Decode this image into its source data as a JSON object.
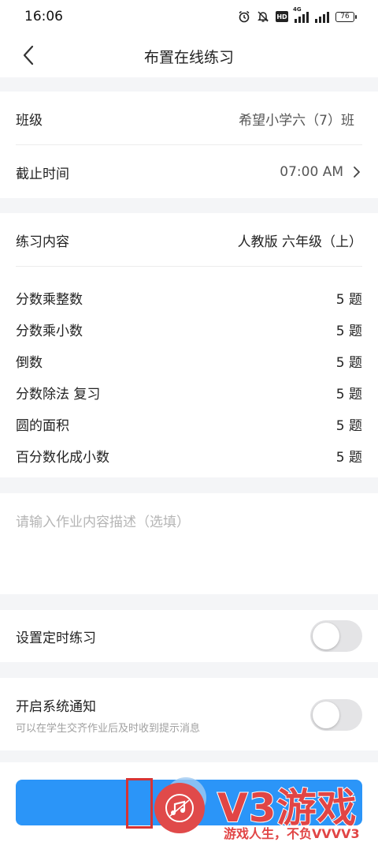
{
  "status_bar": {
    "time": "16:06",
    "hd_label": "HD",
    "network": "4G",
    "battery": "76"
  },
  "nav": {
    "title": "布置在线练习",
    "back_icon": "chevron-left-icon"
  },
  "class_row": {
    "label": "班级",
    "value": "希望小学六（7）班"
  },
  "deadline_row": {
    "label": "截止时间",
    "value": "07:00 AM"
  },
  "content": {
    "label": "练习内容",
    "value": "人教版 六年级（上）",
    "topics": [
      {
        "name": "分数乘整数",
        "count": "5 题"
      },
      {
        "name": "分数乘小数",
        "count": "5 题"
      },
      {
        "name": "倒数",
        "count": "5 题"
      },
      {
        "name": "分数除法 复习",
        "count": "5 题"
      },
      {
        "name": "圆的面积",
        "count": "5 题"
      },
      {
        "name": "百分数化成小数",
        "count": "5 题"
      }
    ]
  },
  "description": {
    "placeholder": "请输入作业内容描述（选填）"
  },
  "timed_practice": {
    "label": "设置定时练习",
    "enabled": false
  },
  "system_notice": {
    "label": "开启系统通知",
    "subtitle": "可以在学生交齐作业后及时收到提示消息",
    "enabled": false
  },
  "submit": {
    "color": "#2b95f8"
  },
  "watermark": {
    "big": "V3游戏",
    "small": "游戏人生，不负VVVV3"
  }
}
